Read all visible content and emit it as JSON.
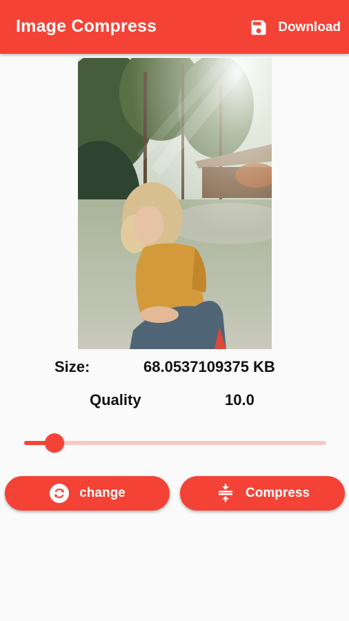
{
  "appbar": {
    "title": "Image Compress",
    "download_label": "Download",
    "download_icon": "save-icon"
  },
  "image": {
    "description_icon": "photo-preview"
  },
  "info": {
    "size_label": "Size:",
    "size_value": "68.0537109375 KB",
    "quality_label": "Quality",
    "quality_value": "10.0"
  },
  "slider": {
    "value": 10,
    "min": 0,
    "max": 100
  },
  "buttons": {
    "change_label": "change",
    "change_icon": "refresh-icon",
    "compress_label": "Compress",
    "compress_icon": "compress-icon"
  },
  "colors": {
    "accent": "#f44336",
    "track_inactive": "#f8c7c3",
    "background": "#fafafa"
  }
}
